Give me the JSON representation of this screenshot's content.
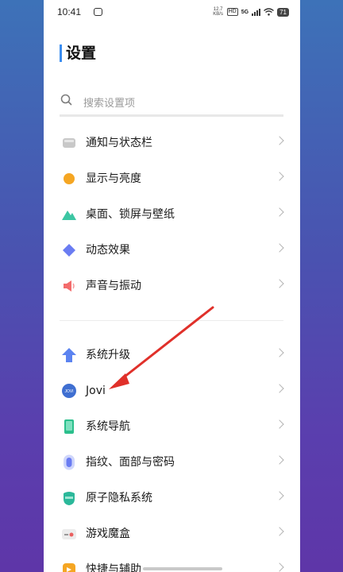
{
  "status_bar": {
    "time": "10:41",
    "net_speed_value": "12.7",
    "net_speed_unit": "KB/s",
    "hd": "HD",
    "network": "5G",
    "battery": "71"
  },
  "header": {
    "title": "设置"
  },
  "search": {
    "placeholder": "搜索设置项"
  },
  "settings": {
    "group1": [
      {
        "label": "通知与状态栏",
        "icon": "notification-icon",
        "color": "#bfbfbf"
      },
      {
        "label": "显示与亮度",
        "icon": "brightness-icon",
        "color": "#f5a623"
      },
      {
        "label": "桌面、锁屏与壁纸",
        "icon": "wallpaper-icon",
        "color": "#3cc6a3"
      },
      {
        "label": "动态效果",
        "icon": "animation-icon",
        "color": "#6a7cf2"
      },
      {
        "label": "声音与振动",
        "icon": "sound-icon",
        "color": "#f36c6c"
      }
    ],
    "group2": [
      {
        "label": "系统升级",
        "icon": "upgrade-icon",
        "color": "#5b83f0"
      },
      {
        "label": "Jovi",
        "icon": "jovi-icon",
        "color": "#3f6fd1",
        "icon_text": "JOVI"
      },
      {
        "label": "系统导航",
        "icon": "navigation-icon",
        "color": "#2bbf8c"
      },
      {
        "label": "指纹、面部与密码",
        "icon": "fingerprint-icon",
        "color": "#6a7cf2"
      },
      {
        "label": "原子隐私系统",
        "icon": "privacy-icon",
        "color": "#2bb89a"
      },
      {
        "label": "游戏魔盒",
        "icon": "game-box-icon",
        "color": "#e96060"
      },
      {
        "label": "快捷与辅助",
        "icon": "shortcut-icon",
        "color": "#f5a623"
      }
    ]
  },
  "annotation": {
    "arrow_color": "#e0302a"
  }
}
